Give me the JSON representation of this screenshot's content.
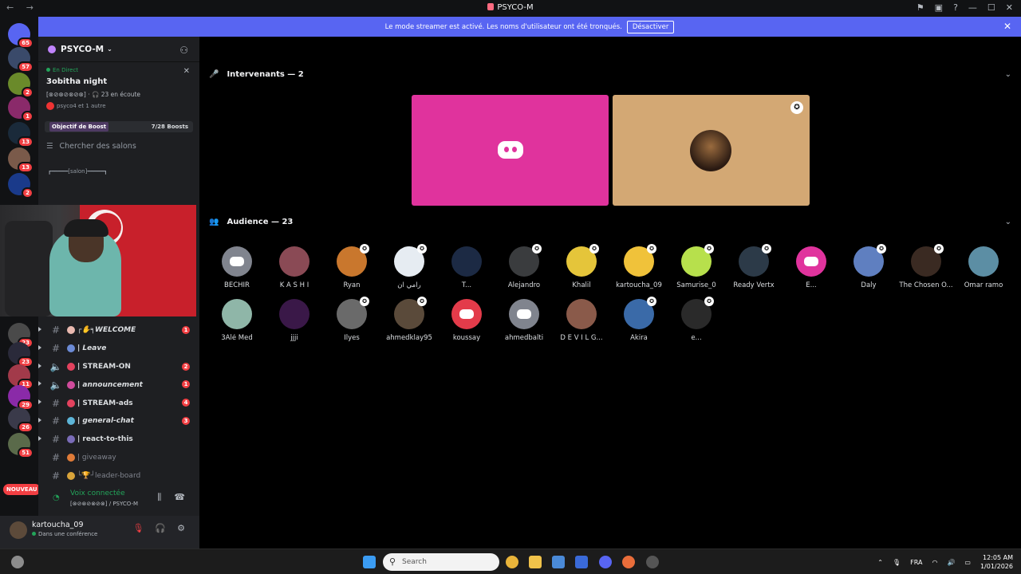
{
  "window": {
    "title": "PSYCO-M",
    "nav": "← →"
  },
  "banner": {
    "text": "Le mode streamer est activé. Les noms d'utilisateur ont été tronqués.",
    "button": "Désactiver"
  },
  "guild_badges": [
    "65",
    "57",
    "2",
    "1",
    "13",
    "13",
    "2",
    "23",
    "23",
    "11",
    "29",
    "26",
    "51"
  ],
  "nouveau": "NOUVEAU",
  "server": {
    "name": "PSYCO-M"
  },
  "event": {
    "live": "En Direct",
    "name": "3obitha night",
    "meta": "[⊗⊘⊗⊘⊗⊘⊗] · 🎧 23 en écoute",
    "members": "psyco4 et 1 autre"
  },
  "boost": {
    "label": "Objectif de Boost",
    "count": "7/28 Boosts"
  },
  "search_channels": "Chercher des salons",
  "category_divider": "┏━━━━━[salon]━━━━━┓",
  "channels": [
    {
      "name": "┌✋╕WELCOME",
      "type": "text",
      "badge": "1",
      "style": "bold-italic",
      "color": "#e9b9b0"
    },
    {
      "name": "| Leave",
      "type": "text",
      "badge": "",
      "style": "bold-italic",
      "color": "#6c8bd6"
    },
    {
      "name": "| STREAM-ON",
      "type": "voice",
      "badge": "2",
      "style": "bold",
      "color": "#e3425e"
    },
    {
      "name": "| announcement",
      "type": "voice",
      "badge": "1",
      "style": "italic",
      "color": "#d04b9c"
    },
    {
      "name": "| STREAM-ads",
      "type": "text",
      "badge": "4",
      "style": "bold",
      "color": "#e3425e"
    },
    {
      "name": "| general-chat",
      "type": "text",
      "badge": "3",
      "style": "italic",
      "color": "#5db5d8"
    },
    {
      "name": "| react-to-this",
      "type": "text",
      "badge": "",
      "style": "bold",
      "color": "#7a6cb8"
    },
    {
      "name": "| giveaway",
      "type": "text",
      "badge": "",
      "style": "muted",
      "color": "#e07b38"
    },
    {
      "name": "└🏆┘leader-board",
      "type": "text",
      "badge": "",
      "style": "muted",
      "color": "#d9a43a"
    }
  ],
  "voice": {
    "state": "Voix connectée",
    "channel": "[⊗⊘⊗⊘⊗⊘⊗] / PSYCO-M"
  },
  "user": {
    "name": "kartoucha_09",
    "status": "Dans une conférence"
  },
  "stage": {
    "speakers_header": "Intervenants — 2",
    "audience_header": "Audience — 23",
    "audience": [
      {
        "name": "BECHIR",
        "color": "#80848e",
        "discord": true,
        "mod": false
      },
      {
        "name": "K A S H I",
        "color": "#8a4a55",
        "discord": false,
        "mod": false
      },
      {
        "name": "Ryan",
        "color": "#c9772d",
        "discord": false,
        "mod": true
      },
      {
        "name": "رامي ان",
        "color": "#e6ecf2",
        "discord": false,
        "mod": true
      },
      {
        "name": "T...",
        "color": "#1c2a44",
        "discord": false,
        "mod": false
      },
      {
        "name": "Alejandro",
        "color": "#3a3c3e",
        "discord": false,
        "mod": true
      },
      {
        "name": "Khalil",
        "color": "#e5c53a",
        "discord": false,
        "mod": true
      },
      {
        "name": "kartoucha_09",
        "color": "#f0c23a",
        "discord": false,
        "mod": true
      },
      {
        "name": "Samurise_0",
        "color": "#b7e04c",
        "discord": false,
        "mod": true
      },
      {
        "name": "Ready Vertx",
        "color": "#2c3a48",
        "discord": false,
        "mod": true
      },
      {
        "name": "E...",
        "color": "#e0339d",
        "discord": true,
        "mod": false
      },
      {
        "name": "Daly",
        "color": "#5f7fc0",
        "discord": false,
        "mod": true
      },
      {
        "name": "The Chosen O...",
        "color": "#3a2a22",
        "discord": false,
        "mod": true
      },
      {
        "name": "Omar ramo",
        "color": "#5c8ea4",
        "discord": false,
        "mod": false
      },
      {
        "name": "3Alé Med",
        "color": "#8fb6a8",
        "discord": false,
        "mod": false
      },
      {
        "name": "jjji",
        "color": "#3a1848",
        "discord": false,
        "mod": false
      },
      {
        "name": "Ilyes",
        "color": "#6a6a6a",
        "discord": false,
        "mod": true
      },
      {
        "name": "ahmedklay95",
        "color": "#5a4a3a",
        "discord": false,
        "mod": true
      },
      {
        "name": "koussay",
        "color": "#e33b4a",
        "discord": true,
        "mod": false
      },
      {
        "name": "ahmedbalti",
        "color": "#80848e",
        "discord": true,
        "mod": false
      },
      {
        "name": "D E V I L G...",
        "color": "#8a5a4a",
        "discord": false,
        "mod": false
      },
      {
        "name": "Akira",
        "color": "#3a6aa8",
        "discord": false,
        "mod": true
      },
      {
        "name": "e...",
        "color": "#2a2a2a",
        "discord": false,
        "mod": true
      }
    ]
  },
  "taskbar": {
    "search": "Search",
    "lang": "FRA",
    "time": "12:05 AM",
    "date": "1/01/2026"
  }
}
